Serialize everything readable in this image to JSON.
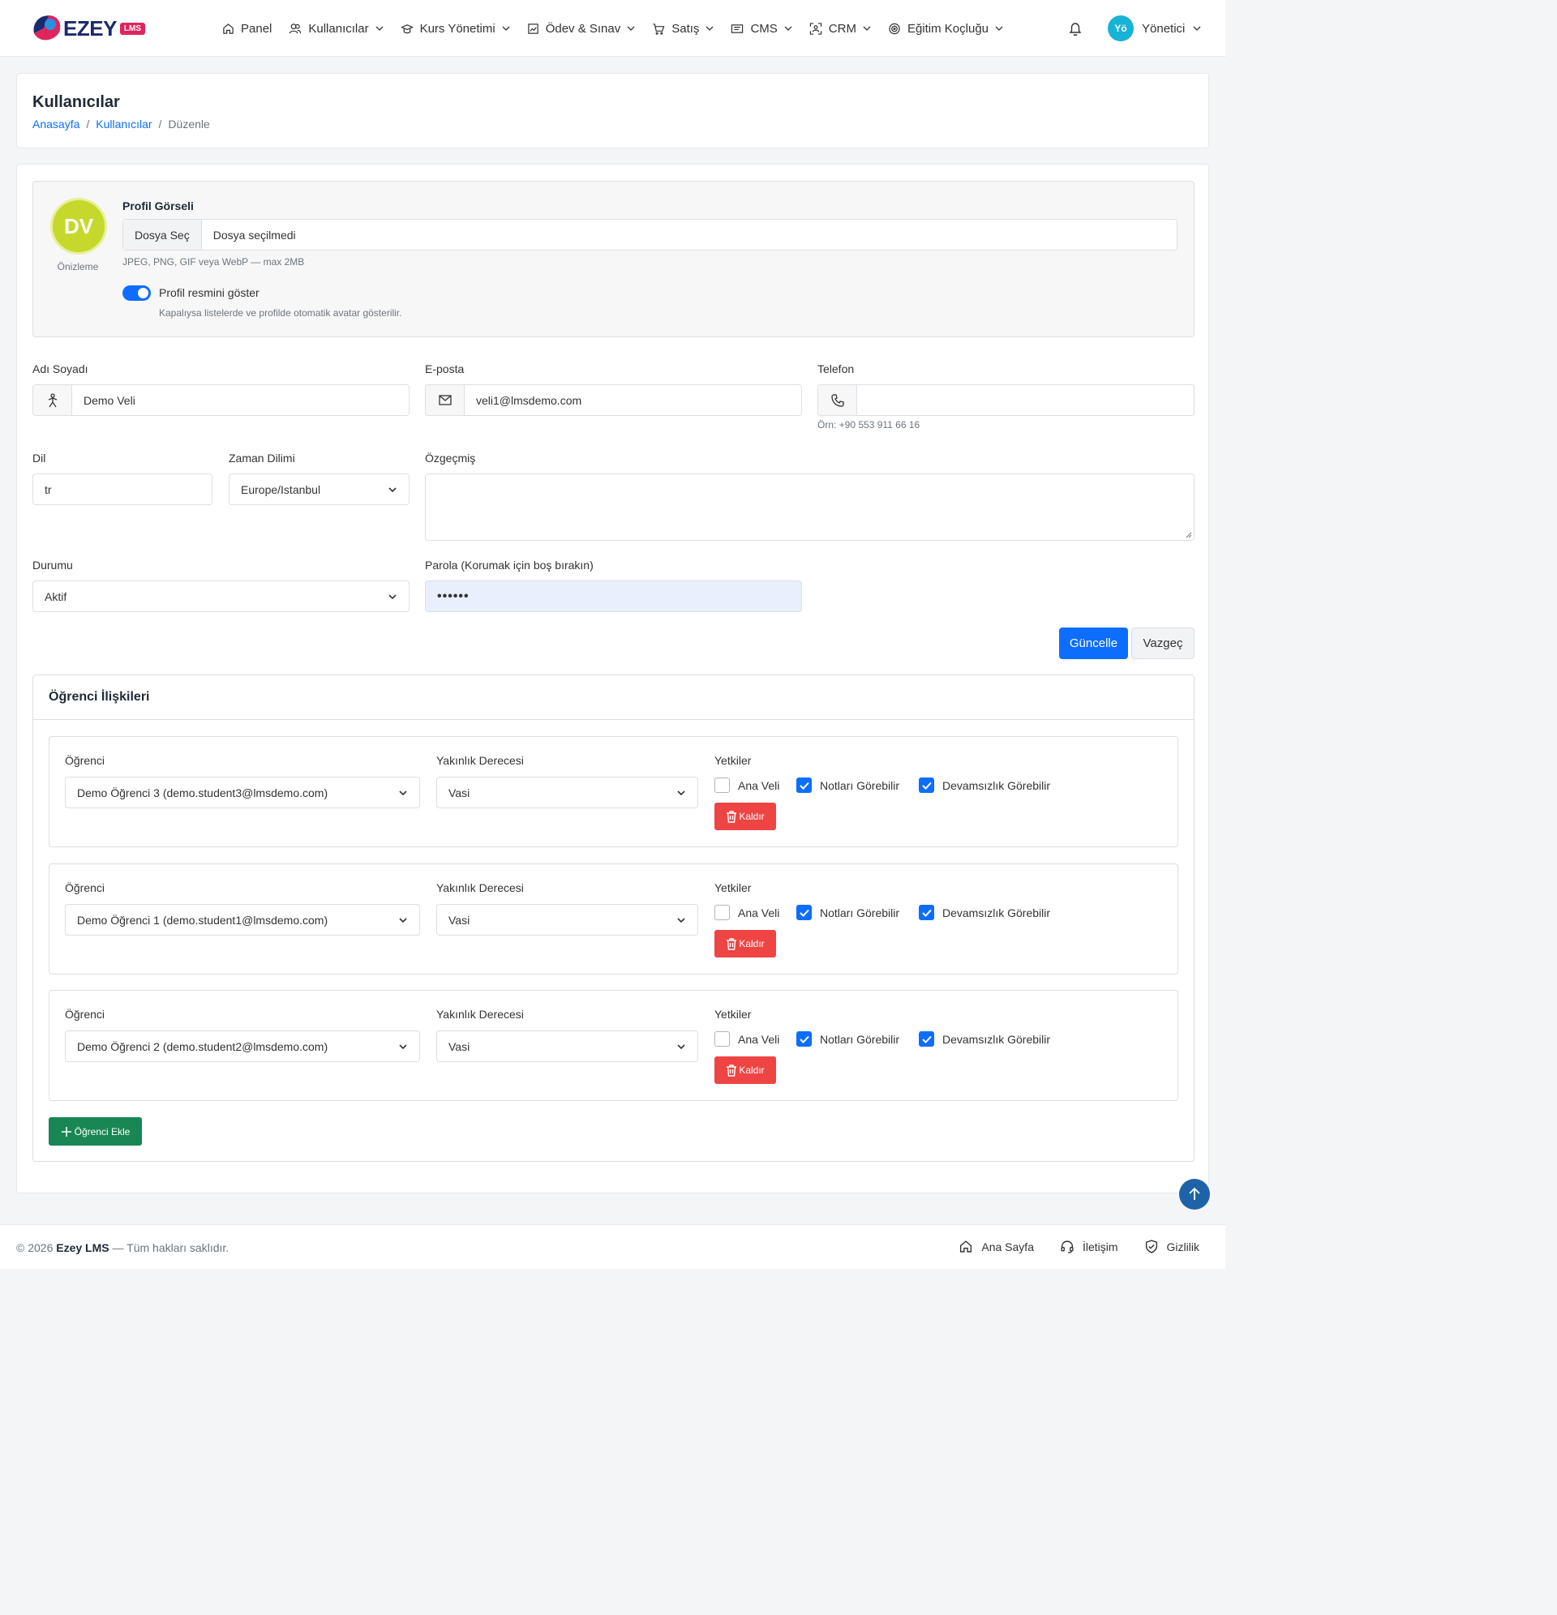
{
  "brand": {
    "name": "EZEY",
    "badge": "LMS",
    "colors": {
      "primary": "#0d6efd",
      "danger": "#ef4444",
      "success": "#198754",
      "avatar": "#c5d92d",
      "user_avatar": "#16b3d6"
    }
  },
  "nav": [
    {
      "label": "Panel",
      "icon": "home-icon"
    },
    {
      "label": "Kullanıcılar",
      "icon": "users-icon"
    },
    {
      "label": "Kurs Yönetimi",
      "icon": "graduation-cap-icon"
    },
    {
      "label": "Ödev & Sınav",
      "icon": "chart-icon"
    },
    {
      "label": "Satış",
      "icon": "cart-icon"
    },
    {
      "label": "CMS",
      "icon": "page-icon"
    },
    {
      "label": "CRM",
      "icon": "target-person-icon"
    },
    {
      "label": "Eğitim Koçluğu",
      "icon": "target-icon"
    }
  ],
  "user": {
    "initials": "Yö",
    "name": "Yönetici"
  },
  "header": {
    "title": "Kullanıcılar",
    "breadcrumb": [
      "Anasayfa",
      "Kullanıcılar",
      "Düzenle"
    ]
  },
  "profile": {
    "initials": "DV",
    "preview_label": "Önizleme",
    "title": "Profil Görseli",
    "file_button": "Dosya Seç",
    "file_status": "Dosya seçilmedi",
    "file_help": "JPEG, PNG, GIF veya WebP — max 2MB",
    "toggle_label": "Profil resmini göster",
    "toggle_help": "Kapalıysa listelerde ve profilde otomatik avatar gösterilir."
  },
  "form": {
    "name_label": "Adı Soyadı",
    "name_value": "Demo Veli",
    "email_label": "E-posta",
    "email_value": "veli1@lmsdemo.com",
    "phone_label": "Telefon",
    "phone_value": "",
    "phone_help": "Örn: +90 553 911 66 16",
    "lang_label": "Dil",
    "lang_value": "tr",
    "tz_label": "Zaman Dilimi",
    "tz_value": "Europe/Istanbul",
    "bio_label": "Özgeçmiş",
    "status_label": "Durumu",
    "status_value": "Aktif",
    "password_label": "Parola (Korumak için boş bırakın)",
    "password_value": "••••••",
    "update_button": "Güncelle",
    "cancel_button": "Vazgeç"
  },
  "relations": {
    "title": "Öğrenci İlişkileri",
    "student_label": "Öğrenci",
    "degree_label": "Yakınlık Derecesi",
    "perm_label": "Yetkiler",
    "perm_names": [
      "Ana Veli",
      "Notları Görebilir",
      "Devamsızlık Görebilir"
    ],
    "remove_label": "Kaldır",
    "add_label": "Öğrenci Ekle",
    "rows": [
      {
        "student": "Demo Öğrenci 3 (demo.student3@lmsdemo.com)",
        "degree": "Vasi",
        "perms": [
          false,
          true,
          true
        ]
      },
      {
        "student": "Demo Öğrenci 1 (demo.student1@lmsdemo.com)",
        "degree": "Vasi",
        "perms": [
          false,
          true,
          true
        ]
      },
      {
        "student": "Demo Öğrenci 2 (demo.student2@lmsdemo.com)",
        "degree": "Vasi",
        "perms": [
          false,
          true,
          true
        ]
      }
    ]
  },
  "footer": {
    "copy_prefix": "© 2026",
    "copy_brand": "Ezey LMS",
    "copy_suffix": "— Tüm hakları saklıdır.",
    "links": [
      "Ana Sayfa",
      "İletişim",
      "Gizlilik"
    ]
  }
}
